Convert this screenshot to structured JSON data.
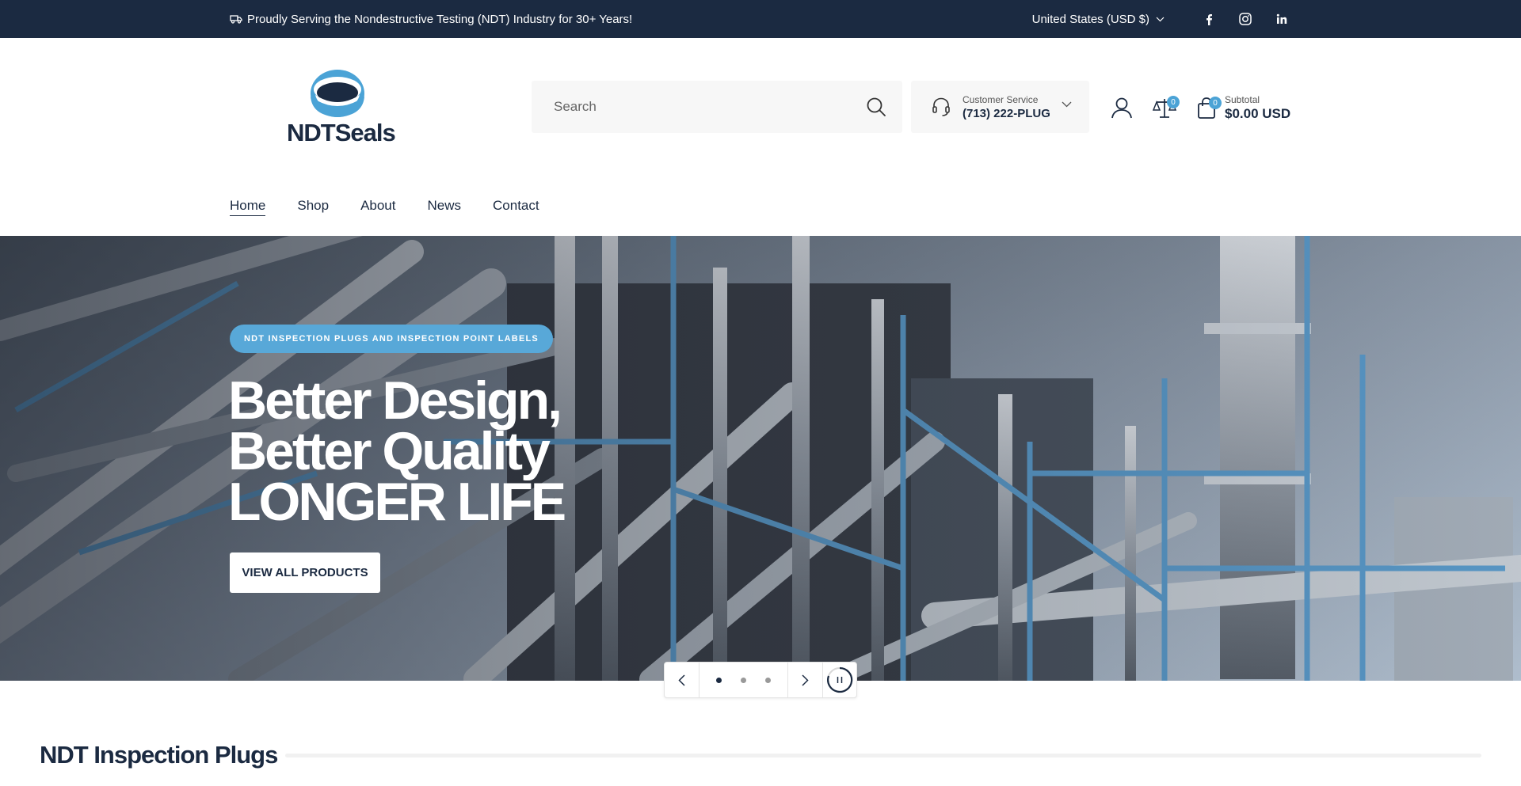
{
  "announcement": {
    "text": "Proudly Serving the Nondestructive Testing (NDT) Industry for 30+ Years!",
    "currency": "United States (USD $)"
  },
  "social": [
    "facebook-icon",
    "instagram-icon",
    "linkedin-icon"
  ],
  "brand": {
    "name": "NDTSeals",
    "color": "#1b2a41",
    "accent": "#4ba3d6"
  },
  "search": {
    "placeholder": "Search"
  },
  "service": {
    "label": "Customer Service",
    "phone": "(713) 222-PLUG"
  },
  "header_icons": {
    "compare_count": "0",
    "cart_count": "0",
    "subtotal_label": "Subtotal",
    "subtotal_value": "$0.00 USD"
  },
  "nav": [
    {
      "label": "Home",
      "active": true
    },
    {
      "label": "Shop",
      "active": false
    },
    {
      "label": "About",
      "active": false
    },
    {
      "label": "News",
      "active": false
    },
    {
      "label": "Contact",
      "active": false
    }
  ],
  "hero": {
    "tag": "NDT INSPECTION PLUGS AND INSPECTION POINT LABELS",
    "headline": [
      "Better Design,",
      "Better Quality",
      "LONGER LIFE"
    ],
    "cta": "VIEW ALL PRODUCTS",
    "slides": 3,
    "active_slide": 1
  },
  "section": {
    "title": "NDT Inspection Plugs"
  }
}
